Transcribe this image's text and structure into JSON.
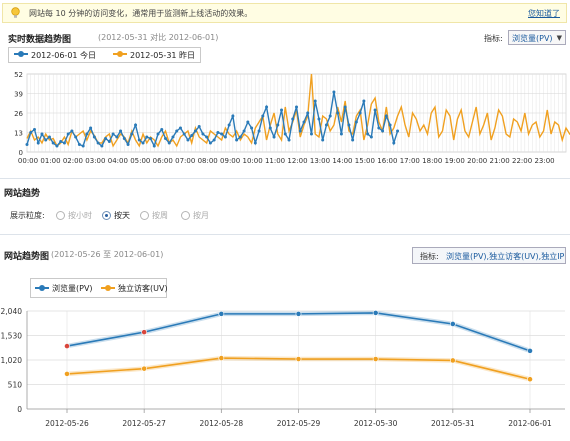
{
  "tip": {
    "text": "网站每 10 分钟的访问变化，通常用于监测新上线活动的效果。",
    "link": "您知道了"
  },
  "realtime": {
    "title": "实时数据趋势图",
    "subtitle": "(2012-05-31 对比 2012-06-01)",
    "metric_label": "指标:",
    "metric_value": "浏览量(PV)",
    "legend": [
      {
        "name": "2012-06-01 今日",
        "color": "#2a7ab8"
      },
      {
        "name": "2012-05-31 昨日",
        "color": "#f0a020"
      }
    ]
  },
  "granularity": {
    "section_title": "网站趋势",
    "label": "展示粒度:",
    "options": [
      {
        "label": "按小时",
        "selected": false
      },
      {
        "label": "按天",
        "selected": true
      },
      {
        "label": "按周",
        "selected": false
      },
      {
        "label": "按月",
        "selected": false
      }
    ]
  },
  "trend": {
    "title": "网站趋势图",
    "subtitle": "(2012-05-26 至 2012-06-01)",
    "metric_label": "指标:",
    "metric_value": "浏览量(PV),独立访客(UV),独立IP",
    "legend": [
      {
        "name": "浏览量(PV)",
        "color": "#2a7ab8"
      },
      {
        "name": "独立访客(UV)",
        "color": "#f0a020"
      }
    ]
  },
  "chart_data": [
    {
      "type": "line",
      "title": "实时数据趋势图",
      "yticks": [
        0,
        13,
        26,
        39,
        52
      ],
      "ylim": [
        0,
        52
      ],
      "x_ticks": [
        "00:00",
        "01:00",
        "02:00",
        "03:00",
        "04:00",
        "05:00",
        "06:00",
        "07:00",
        "08:00",
        "09:00",
        "10:00",
        "11:00",
        "12:00",
        "13:00",
        "14:00",
        "15:00",
        "16:00",
        "17:00",
        "18:00",
        "19:00",
        "20:00",
        "21:00",
        "22:00",
        "23:00"
      ],
      "x_range_hours": [
        0,
        24
      ],
      "grid": true,
      "legend": "top-left",
      "series": [
        {
          "name": "2012-06-01 今日",
          "color": "#2a7ab8",
          "markers": true,
          "values": [
            5,
            13,
            15,
            6,
            12,
            8,
            10,
            6,
            4,
            7,
            6,
            12,
            14,
            10,
            5,
            4,
            12,
            16,
            10,
            6,
            4,
            9,
            7,
            12,
            10,
            14,
            9,
            5,
            12,
            18,
            8,
            6,
            10,
            9,
            4,
            12,
            15,
            9,
            6,
            10,
            14,
            16,
            12,
            8,
            11,
            14,
            17,
            12,
            10,
            6,
            8,
            13,
            12,
            10,
            18,
            24,
            8,
            10,
            14,
            20,
            16,
            6,
            14,
            24,
            30,
            16,
            10,
            18,
            28,
            12,
            8,
            22,
            30,
            14,
            20,
            26,
            12,
            34,
            22,
            8,
            18,
            24,
            40,
            26,
            12,
            30,
            18,
            8,
            20,
            26,
            34,
            12,
            10,
            28,
            16,
            14,
            24,
            18,
            6,
            14
          ]
        },
        {
          "name": "2012-05-31 昨日",
          "color": "#f0a020",
          "markers": false,
          "values": [
            9,
            14,
            8,
            10,
            6,
            12,
            8,
            9,
            4,
            6,
            10,
            5,
            14,
            10,
            12,
            14,
            8,
            14,
            11,
            6,
            6,
            10,
            12,
            4,
            8,
            12,
            10,
            6,
            14,
            8,
            4,
            12,
            6,
            10,
            8,
            4,
            10,
            14,
            6,
            8,
            4,
            10,
            12,
            14,
            6,
            16,
            10,
            8,
            6,
            14,
            12,
            10,
            8,
            16,
            12,
            10,
            14,
            8,
            12,
            10,
            6,
            16,
            20,
            24,
            8,
            18,
            26,
            12,
            8,
            30,
            14,
            20,
            28,
            10,
            18,
            24,
            52,
            12,
            10,
            24,
            22,
            14,
            18,
            30,
            20,
            34,
            14,
            12,
            24,
            28,
            8,
            18,
            32,
            36,
            20,
            14,
            30,
            12,
            16,
            24,
            30,
            18,
            10,
            26,
            22,
            14,
            18,
            12,
            26,
            30,
            10,
            14,
            28,
            24,
            8,
            22,
            28,
            14,
            10,
            20,
            30,
            12,
            18,
            26,
            8,
            16,
            28,
            24,
            12,
            10,
            22,
            20,
            14,
            26,
            12,
            18,
            20,
            10,
            14,
            28,
            12,
            20,
            18,
            8,
            16,
            12,
            10,
            14,
            12,
            10,
            14,
            8,
            16,
            12,
            10,
            12,
            10,
            16,
            20,
            14,
            8,
            12,
            10,
            9,
            10,
            10,
            9,
            8,
            10,
            20
          ]
        }
      ]
    },
    {
      "type": "line",
      "title": "网站趋势图",
      "categories": [
        "2012-05-26",
        "2012-05-27",
        "2012-05-28",
        "2012-05-29",
        "2012-05-30",
        "2012-05-31",
        "2012-06-01"
      ],
      "yticks": [
        0,
        510,
        1020,
        1530,
        2040
      ],
      "ytick_labels": [
        "0",
        "510",
        "1,020",
        "1,530",
        "2,040"
      ],
      "ylim": [
        0,
        2040
      ],
      "grid": true,
      "legend": "top-left",
      "series": [
        {
          "name": "浏览量(PV)",
          "color": "#2a7ab8",
          "values": [
            1310,
            1600,
            1980,
            1980,
            2000,
            1770,
            1210
          ]
        },
        {
          "name": "独立访客(UV)",
          "color": "#f0a020",
          "values": [
            730,
            840,
            1060,
            1040,
            1040,
            1010,
            620
          ]
        }
      ]
    }
  ]
}
